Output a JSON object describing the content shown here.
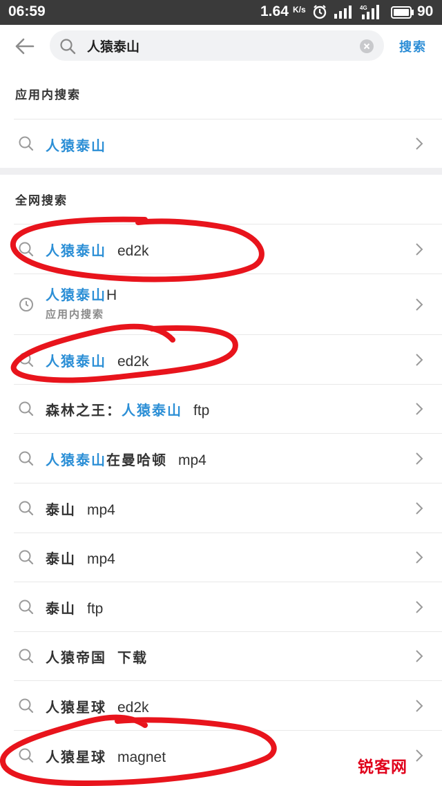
{
  "status_bar": {
    "time": "06:59",
    "speed": "1.64",
    "speed_unit": "K/s",
    "network_label": "4G",
    "battery": "90"
  },
  "search": {
    "query": "人猿泰山",
    "button_label": "搜索"
  },
  "in_app_section": {
    "title": "应用内搜索",
    "items": [
      {
        "highlight": "人猿泰山",
        "icon": "search-icon"
      }
    ]
  },
  "web_section": {
    "title": "全网搜索",
    "items": [
      {
        "icon": "search-icon",
        "pre": "",
        "highlight": "人猿泰山",
        "mid": "",
        "suffix": "ed2k"
      },
      {
        "icon": "clock-icon",
        "pre": "",
        "highlight": "人猿泰山",
        "mid": "H",
        "suffix": "",
        "sub": "应用内搜索"
      },
      {
        "icon": "search-icon",
        "pre": "",
        "highlight": "人猿泰山",
        "mid": "",
        "suffix": "ed2k"
      },
      {
        "icon": "search-icon",
        "pre": "森林之王：",
        "highlight": "人猿泰山",
        "mid": "",
        "suffix": "ftp"
      },
      {
        "icon": "search-icon",
        "pre": "",
        "highlight": "人猿泰山",
        "mid": "在曼哈顿",
        "suffix": "mp4"
      },
      {
        "icon": "search-icon",
        "pre": "泰山",
        "highlight": "",
        "mid": "",
        "suffix": "mp4"
      },
      {
        "icon": "search-icon",
        "pre": "泰山",
        "highlight": "",
        "mid": "",
        "suffix": "mp4"
      },
      {
        "icon": "search-icon",
        "pre": "泰山",
        "highlight": "",
        "mid": "",
        "suffix": "ftp"
      },
      {
        "icon": "search-icon",
        "pre": "人猿帝国",
        "highlight": "",
        "mid": "",
        "suffix": "下载"
      },
      {
        "icon": "search-icon",
        "pre": "人猿星球",
        "highlight": "",
        "mid": "",
        "suffix": "ed2k"
      },
      {
        "icon": "search-icon",
        "pre": "人猿星球",
        "highlight": "",
        "mid": "",
        "suffix": "magnet"
      }
    ]
  },
  "watermark": "锐客网",
  "colors": {
    "highlight": "#2c8fd6",
    "annotation": "#e8141c",
    "status_bar_bg": "#3a3a3a"
  }
}
